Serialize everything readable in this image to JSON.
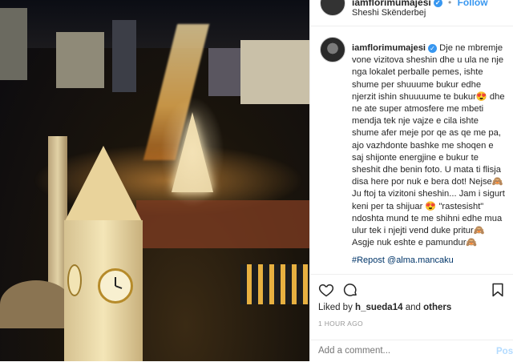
{
  "header": {
    "username": "iamflorimumajesi",
    "follow_label": "Follow",
    "separator": "•",
    "location": "Sheshi Skënderbej"
  },
  "caption": {
    "username": "iamflorimumajesi",
    "text": "Dje ne mbremje vone vizitova sheshin dhe u ula ne nje nga lokalet perballe pemes, ishte shume per shuuume bukur edhe njerzit ishin shuuuume te bukur😍 dhe ne ate super atmosfere me mbeti mendja tek nje vajze e cila ishte shume afer meje por qe as qe me pa, ajo vazhdonte bashke me shoqen e saj shijonte energjine e bukur te sheshit dhe benin foto. U mata ti flisja disa here por nuk e bera dot! Nejse🙈 Ju ftoj ta vizitoni sheshin... Jam i sigurt keni per ta shijuar 😍 \"rastesisht\" ndoshta mund te me shihni edhe mua ulur tek i njejti vend duke pritur🙈 Asgje nuk eshte e pamundur🙈",
    "repost": "#Repost @alma.mancaku"
  },
  "icons": {
    "like": "heart-icon",
    "comment": "comment-bubble-icon",
    "save": "bookmark-icon",
    "verified": "verified-badge-icon"
  },
  "likes": {
    "prefix": "Liked by",
    "user": "h_sueda14",
    "conjunction": "and",
    "others": "others"
  },
  "timestamp": "1 HOUR AGO",
  "comment_box": {
    "placeholder": "Add a comment...",
    "post_label": "Post"
  },
  "colors": {
    "link": "#3897f0",
    "hashtag": "#003569",
    "muted": "#999999"
  }
}
